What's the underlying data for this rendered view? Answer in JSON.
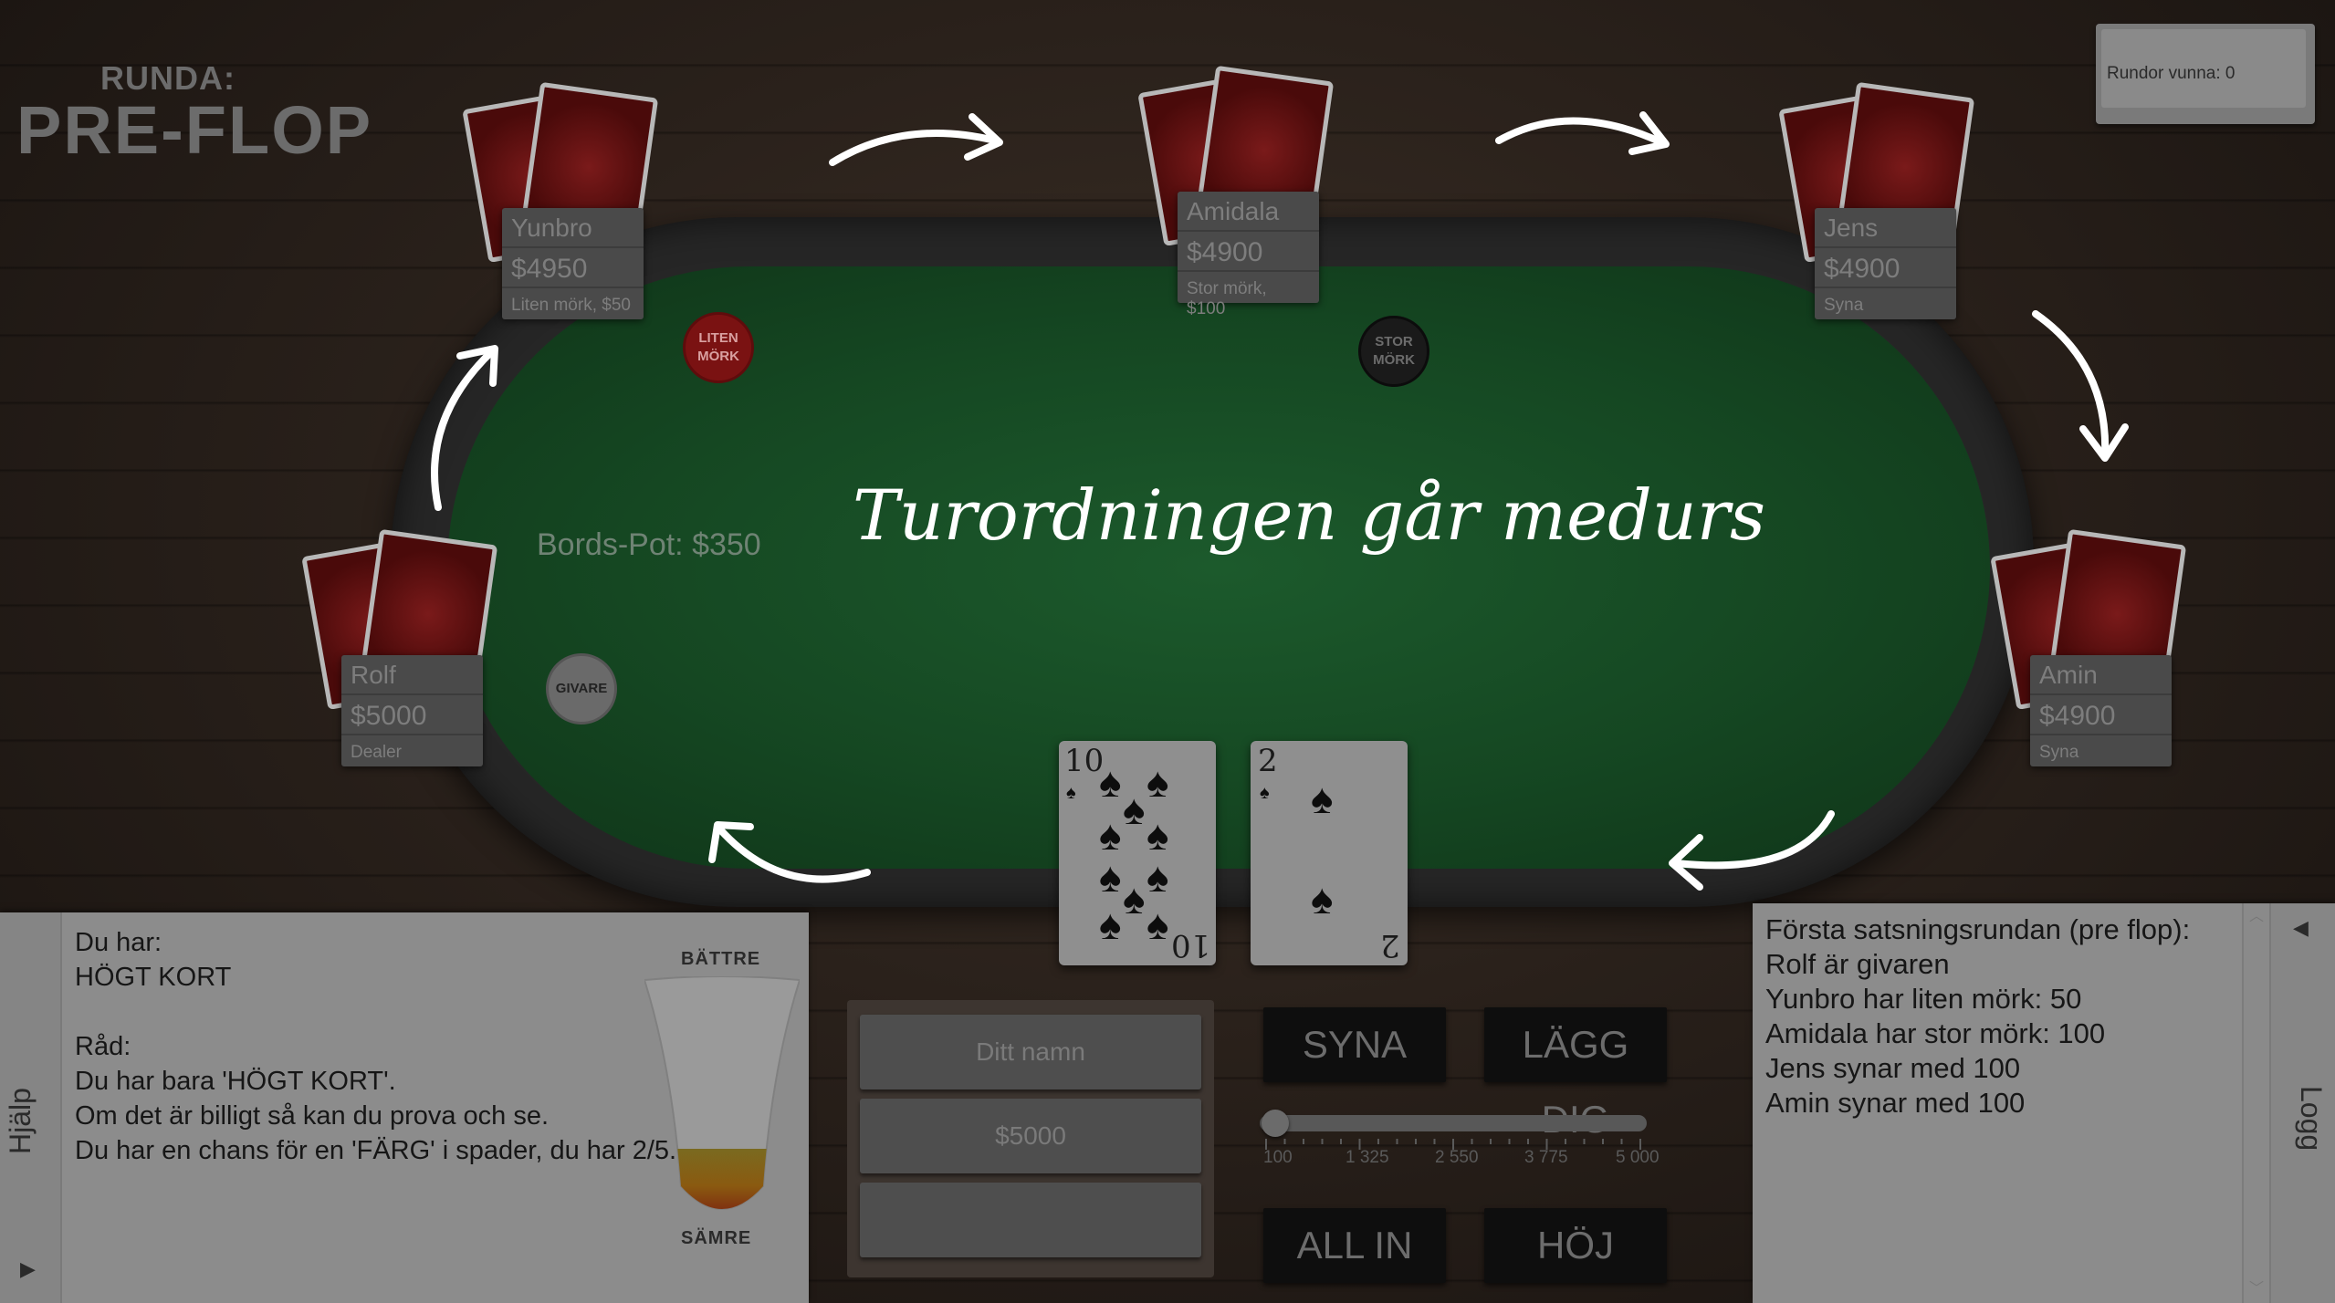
{
  "round": {
    "label": "RUNDA:",
    "value": "PRE-FLOP"
  },
  "rounds_won": "Rundor vunna: 0",
  "headline": "Turordningen går medurs",
  "pot": "Bords-Pot: $350",
  "chips": {
    "small_blind": "LITEN MÖRK",
    "big_blind": "STOR MÖRK",
    "dealer": "GIVARE"
  },
  "players": [
    {
      "name": "Yunbro",
      "money": "$4950",
      "status": "Liten mörk, $50"
    },
    {
      "name": "Amidala",
      "money": "$4900",
      "status": "Stor mörk, $100"
    },
    {
      "name": "Jens",
      "money": "$4900",
      "status": "Syna"
    },
    {
      "name": "Rolf",
      "money": "$5000",
      "status": "Dealer"
    },
    {
      "name": "Amin",
      "money": "$4900",
      "status": "Syna"
    }
  ],
  "hand": [
    {
      "rank": "10",
      "suit": "spade"
    },
    {
      "rank": "2",
      "suit": "spade"
    }
  ],
  "help": {
    "tab_label": "Hjälp",
    "lines": [
      "Du har:",
      "HÖGT KORT",
      "",
      "Råd:",
      "Du har bara 'HÖGT KORT'.",
      "Om det är billigt så kan du prova och se.",
      "Du har en chans för en 'FÄRG' i spader, du har 2/5."
    ],
    "meter_top": "BÄTTRE",
    "meter_bottom": "SÄMRE",
    "hand_strength": 0.3
  },
  "user": {
    "name_placeholder": "Ditt namn",
    "money": "$5000",
    "extra": ""
  },
  "actions": {
    "call": "SYNA",
    "fold": "LÄGG DIG",
    "all_in": "ALL IN",
    "raise": "HÖJ"
  },
  "slider": {
    "min": 100,
    "max": 5000,
    "value": 100,
    "ticks": [
      "100",
      "1 325",
      "2 550",
      "3 775",
      "5 000"
    ]
  },
  "log": {
    "tab_label": "Logg",
    "lines": [
      "Första satsningsrundan (pre flop):",
      "Rolf är givaren",
      "Yunbro har liten mörk: 50",
      "Amidala har stor mörk: 100",
      "Jens synar med 100",
      "Amin synar med 100"
    ]
  },
  "colors": {
    "felt": "#154722",
    "arrow": "#ffffff",
    "small_blind_chip": "#7a1212",
    "big_blind_chip": "#1a1a1a"
  }
}
